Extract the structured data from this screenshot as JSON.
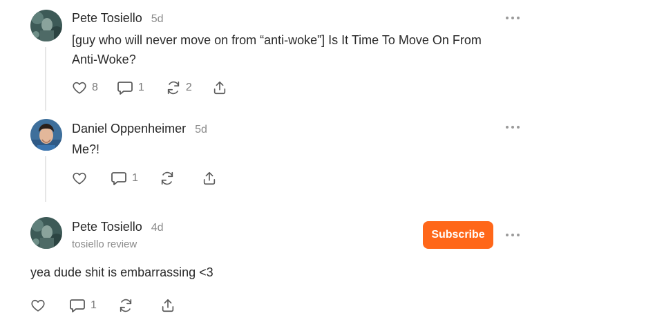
{
  "comments": [
    {
      "author": "Pete Tosiello",
      "time": "5d",
      "text": "[guy who will never move on from “anti-woke”] Is It Time To Move On From Anti-Woke?",
      "text_line1": "[guy who will never move on from “anti-woke”] Is It Time To Move On From",
      "text_line2": "Anti-Woke?",
      "likes": "8",
      "replies": "1",
      "restacks": "2"
    },
    {
      "author": "Daniel Oppenheimer",
      "time": "5d",
      "text": "Me?!",
      "likes": "",
      "replies": "1",
      "restacks": ""
    },
    {
      "author": "Pete Tosiello",
      "time": "4d",
      "subtitle": "tosiello review",
      "subscribe_label": "Subscribe",
      "text": "yea dude shit is embarrassing <3",
      "likes": "",
      "replies": "1",
      "restacks": ""
    }
  ],
  "icons": {
    "like": "heart-icon",
    "reply": "comment-bubble-icon",
    "restack": "restack-arrows-icon",
    "share": "share-upload-icon",
    "more": "more-dots-icon"
  },
  "colors": {
    "accent": "#ff6719",
    "muted_text": "#8a8a8a",
    "thread_line": "#e6e6e6"
  }
}
